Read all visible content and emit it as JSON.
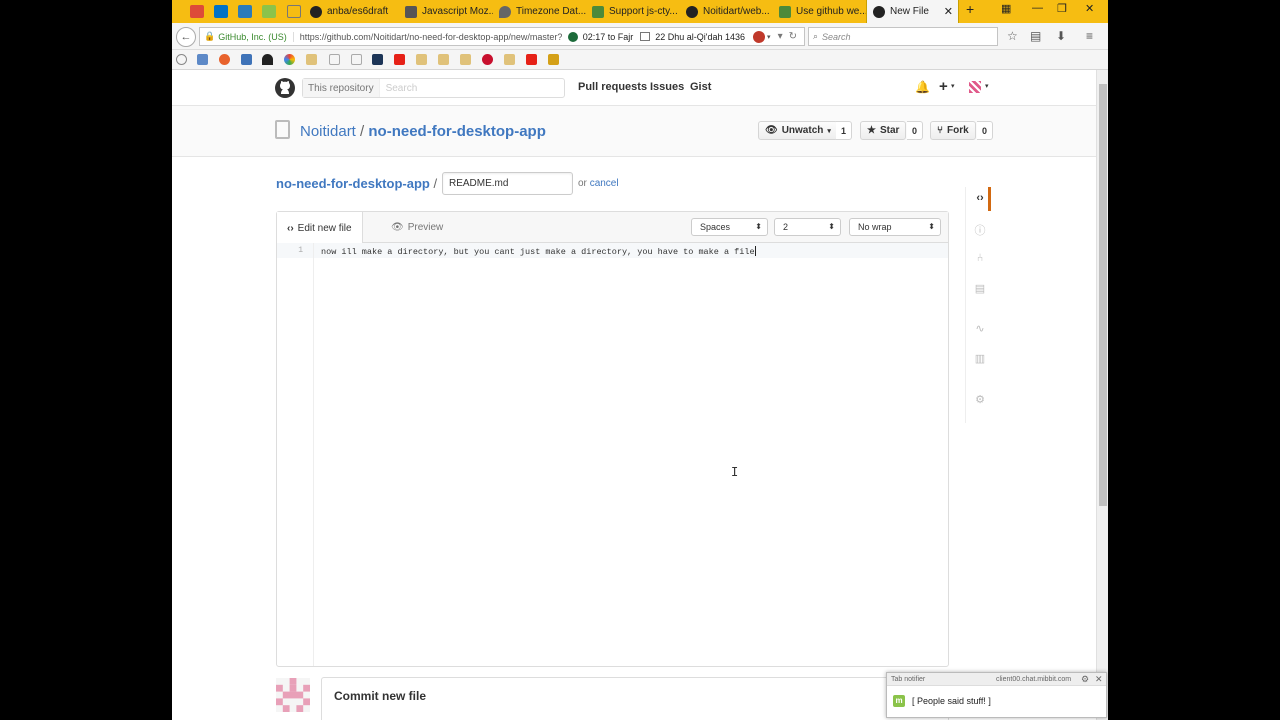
{
  "browser": {
    "tabs": [
      {
        "title": "anba/es6draft",
        "icon": "github-icon"
      },
      {
        "title": "Javascript Moz...",
        "icon": "mdn-icon"
      },
      {
        "title": "Timezone Dat...",
        "icon": "pin-icon"
      },
      {
        "title": "Support js-cty...",
        "icon": "puzzle-icon"
      },
      {
        "title": "Noitidart/web...",
        "icon": "github-icon"
      },
      {
        "title": "Use github we...",
        "icon": "puzzle-icon"
      },
      {
        "title": "New File",
        "icon": "github-icon",
        "active": true
      }
    ],
    "identity": "GitHub, Inc. (US)",
    "url": "https://github.com/Noitidart/no-need-for-desktop-app/new/master?r",
    "prayer_time": "02:17 to Fajr",
    "hijri_date": "22 Dhu al-Qi'dah 1436",
    "search_placeholder": "Search",
    "accent_color": "#f6bd12"
  },
  "github": {
    "scope_label": "This repository",
    "search_placeholder": "Search",
    "nav": [
      "Pull requests",
      "Issues",
      "Gist"
    ],
    "owner": "Noitidart",
    "separator": "/",
    "repo": "no-need-for-desktop-app",
    "actions": {
      "watch_label": "Unwatch",
      "watch_count": "1",
      "star_label": "Star",
      "star_count": "0",
      "fork_label": "Fork",
      "fork_count": "0"
    },
    "breadcrumb_repo": "no-need-for-desktop-app",
    "breadcrumb_sep": "/",
    "filename": "README.md",
    "or_text": "or",
    "cancel_label": "cancel",
    "editor": {
      "tab_edit": "Edit new file",
      "tab_preview": "Preview",
      "indent_mode": "Spaces",
      "indent_size": "2",
      "wrap_mode": "No wrap",
      "line_number": "1",
      "line_text": "now ill make a directory, but you cant just make a directory, you have to make a file"
    },
    "commit_title": "Commit new file"
  },
  "notifier": {
    "title": "Tab notifier",
    "source": "client00.chat.mibbit.com",
    "message": "[ People said stuff! ]"
  }
}
